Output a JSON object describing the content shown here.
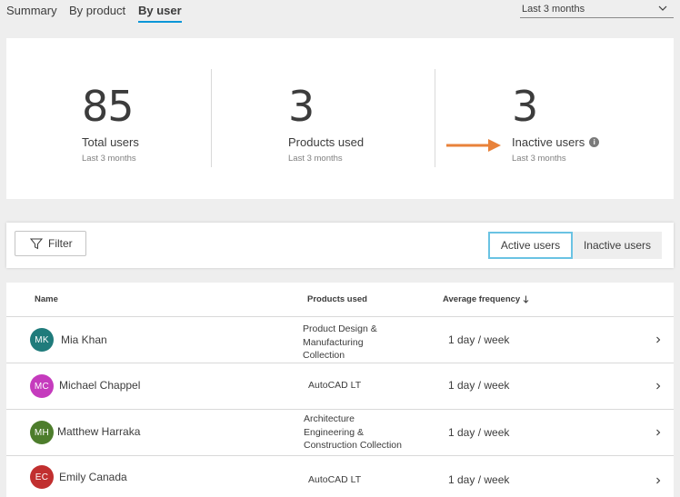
{
  "tabs": [
    {
      "label": "Summary"
    },
    {
      "label": "By product"
    },
    {
      "label": "By user"
    }
  ],
  "period": {
    "selected": "Last 3 months"
  },
  "stats": [
    {
      "value": "85",
      "label": "Total users",
      "sub": "Last 3 months"
    },
    {
      "value": "3",
      "label": "Products used",
      "sub": "Last 3 months"
    },
    {
      "value": "3",
      "label": "Inactive users",
      "sub": "Last 3 months"
    }
  ],
  "filter": {
    "label": "Filter"
  },
  "segments": {
    "active": "Active users",
    "inactive": "Inactive users"
  },
  "table": {
    "headers": {
      "name": "Name",
      "products": "Products used",
      "frequency": "Average frequency"
    },
    "rows": [
      {
        "initials": "MK",
        "name": "Mia Khan",
        "product_lines": [
          "Product Design &",
          "Manufacturing",
          "Collection"
        ],
        "frequency": "1 day / week",
        "avatar_color": "#1f7b7b"
      },
      {
        "initials": "MC",
        "name": "Michael Chappel",
        "product_lines": [
          "AutoCAD LT"
        ],
        "frequency": "1 day / week",
        "avatar_color": "#c53bbd"
      },
      {
        "initials": "MH",
        "name": "Matthew Harraka",
        "product_lines": [
          "Architecture",
          "Engineering &",
          "Construction Collection"
        ],
        "frequency": "1 day / week",
        "avatar_color": "#4d7d2c"
      },
      {
        "initials": "EC",
        "name": "Emily Canada",
        "product_lines": [
          "AutoCAD LT"
        ],
        "frequency": "1 day / week",
        "avatar_color": "#c12f2f"
      }
    ]
  },
  "colors": {
    "accent": "#0696d7",
    "arrow": "#e8823a",
    "segment_border": "#6ac3e3"
  }
}
